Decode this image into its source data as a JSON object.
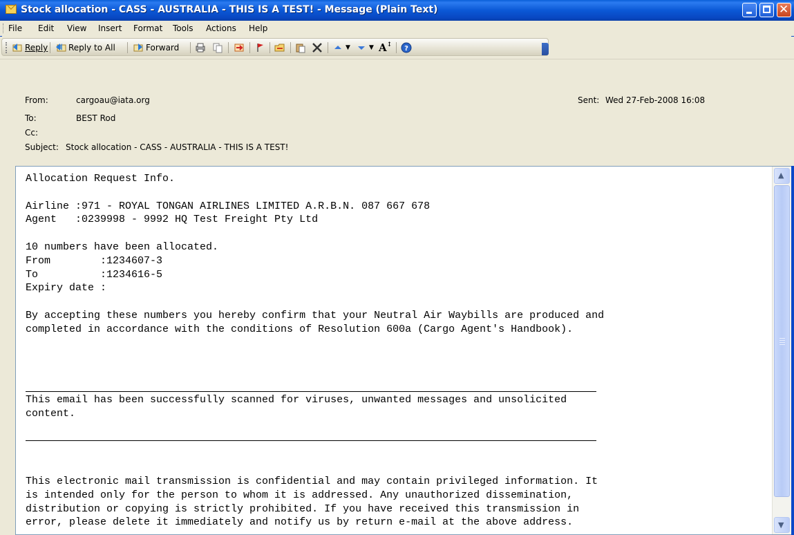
{
  "window": {
    "title": "Stock allocation - CASS - AUSTRALIA - THIS IS A TEST! - Message (Plain Text)",
    "accent_color": "#0a5fd8"
  },
  "menu": [
    "File",
    "Edit",
    "View",
    "Insert",
    "Format",
    "Tools",
    "Actions",
    "Help"
  ],
  "toolbar": {
    "reply_label": "Reply",
    "reply_all_label": "Reply to All",
    "forward_label": "Forward",
    "icons": [
      "print-icon",
      "copy-icon",
      "move-to-folder-icon",
      "flag-icon",
      "open-folder-icon",
      "paste-icon",
      "delete-icon",
      "previous-item-icon",
      "next-item-icon",
      "font-size-icon",
      "help-icon"
    ]
  },
  "header": {
    "from_label": "From:",
    "from_value": "cargoau@iata.org",
    "to_label": "To:",
    "to_value": "BEST Rod",
    "cc_label": "Cc:",
    "cc_value": "",
    "subject_label": "Subject:",
    "subject_value": "Stock allocation - CASS - AUSTRALIA - THIS IS A TEST!",
    "sent_label": "Sent:",
    "sent_value": "Wed 27-Feb-2008 16:08"
  },
  "message": {
    "block1": "Allocation Request Info.\n\nAirline :971 - ROYAL TONGAN AIRLINES LIMITED A.R.B.N. 087 667 678\nAgent   :0239998 - 9992 HQ Test Freight Pty Ltd\n\n10 numbers have been allocated.\nFrom        :1234607-3\nTo          :1234616-5\nExpiry date :\n\nBy accepting these numbers you hereby confirm that your Neutral Air Waybills are produced and\ncompleted in accordance with the conditions of Resolution 600a (Cargo Agent's Handbook).",
    "block2": "This email has been successfully scanned for viruses, unwanted messages and unsolicited\ncontent.",
    "block3": "This electronic mail transmission is confidential and may contain privileged information. It\nis intended only for the person to whom it is addressed. Any unauthorized dissemination,\ndistribution or copying is strictly prohibited. If you have received this transmission in\nerror, please delete it immediately and notify us by return e-mail at the above address."
  }
}
